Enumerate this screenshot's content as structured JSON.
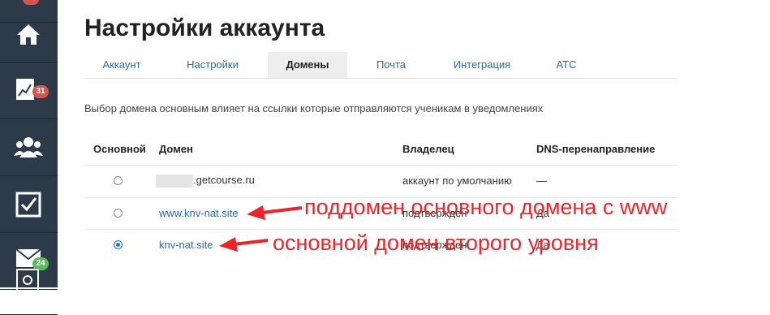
{
  "sidebar": {
    "badges": {
      "stats": "31",
      "mail": "24"
    }
  },
  "page": {
    "title": "Настройки аккаунта",
    "tabs": [
      "Аккаунт",
      "Настройки",
      "Домены",
      "Почта",
      "Интеграция",
      "АТС"
    ],
    "active_tab": "Домены",
    "description": "Выбор домена основным влияет на ссылки которые отправляются ученикам в уведомлениях"
  },
  "table": {
    "headers": [
      "Основной",
      "Домен",
      "Владелец",
      "DNS-перенаправление"
    ],
    "rows": [
      {
        "primary": false,
        "domain": ".getcourse.ru",
        "owner": "аккаунт по умолчанию",
        "dns": "—"
      },
      {
        "primary": false,
        "domain": "www.knv-nat.site",
        "owner": "подтвержден",
        "dns": "Да"
      },
      {
        "primary": true,
        "domain": "knv-nat.site",
        "owner": "подтвержден",
        "dns": "Да"
      }
    ]
  },
  "annotations": {
    "subdomain": "поддомен основного домена с www",
    "main": "основной домен второго уровня"
  },
  "colors": {
    "annotation": "#e8262c",
    "sidebar": "#2d3a4a",
    "link": "#2b6ba3"
  }
}
